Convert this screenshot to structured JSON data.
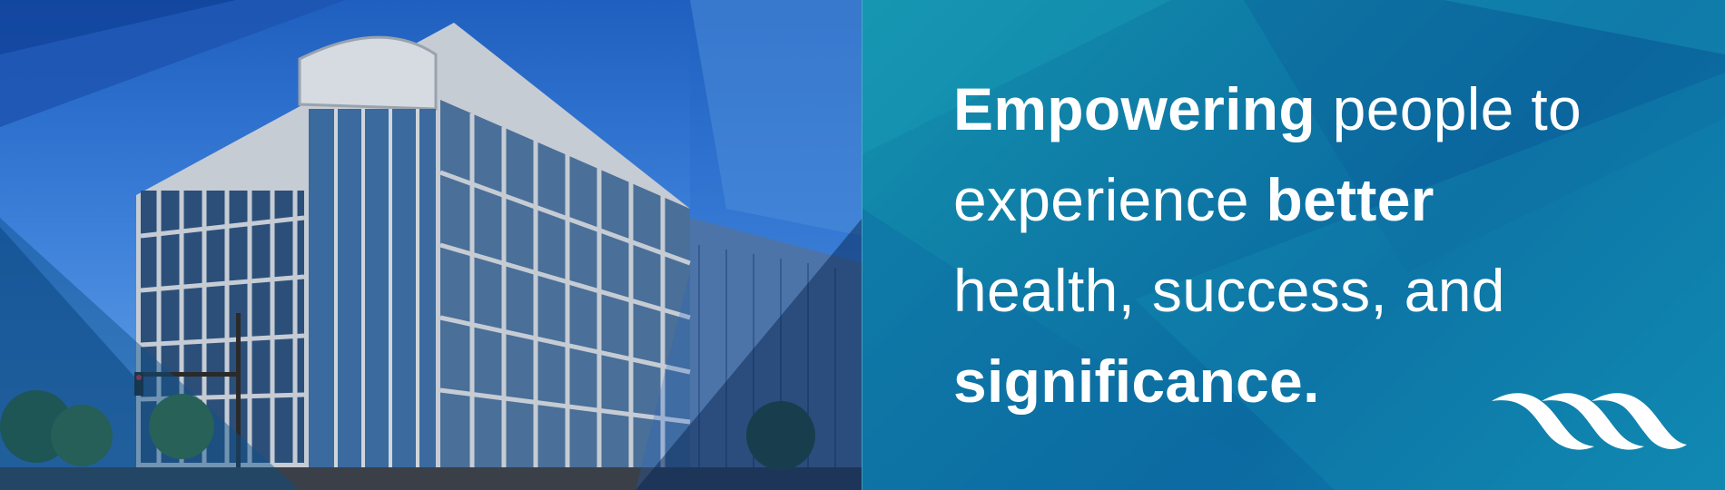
{
  "headline": {
    "w1_bold": "Empowering",
    "w1_rest": " people to",
    "w2_rest": "experience ",
    "w2_bold": "better",
    "w3": "health, success, and",
    "w4_bold": "significance."
  },
  "colors": {
    "panel_teal": "#0e7aa6",
    "sky_blue": "#3b7fd9",
    "text": "#ffffff"
  },
  "icons": [
    "wave-logo-icon"
  ]
}
